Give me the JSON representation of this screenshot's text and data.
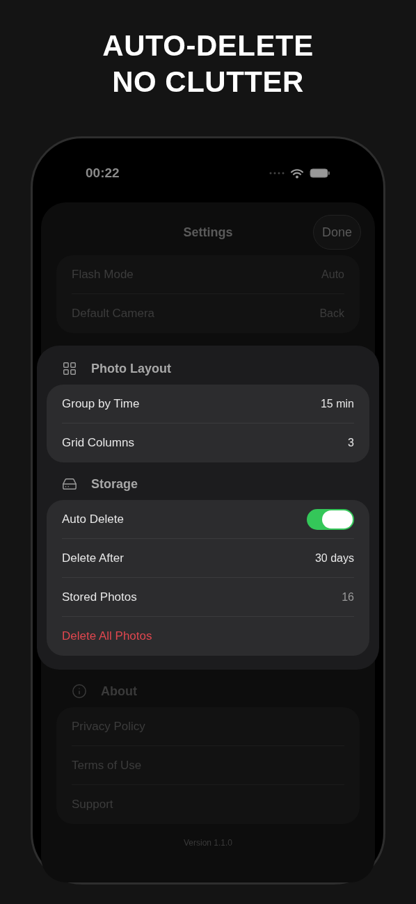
{
  "headline": [
    "AUTO-DELETE",
    "NO CLUTTER"
  ],
  "status_bar": {
    "time": "00:22"
  },
  "nav": {
    "title": "Settings",
    "done": "Done"
  },
  "sections": [
    {
      "focused": false,
      "rows": [
        {
          "kind": "value",
          "label": "Flash Mode",
          "value": "Auto"
        },
        {
          "kind": "value",
          "label": "Default Camera",
          "value": "Back"
        }
      ]
    },
    {
      "kind": "layout",
      "title": "Photo Layout",
      "focused": true,
      "rows": [
        {
          "kind": "value",
          "label": "Group by Time",
          "value": "15 min"
        },
        {
          "kind": "value",
          "label": "Grid Columns",
          "value": "3"
        }
      ]
    },
    {
      "kind": "storage",
      "title": "Storage",
      "focused": true,
      "rows": [
        {
          "kind": "toggle",
          "label": "Auto Delete",
          "on": true
        },
        {
          "kind": "value",
          "label": "Delete After",
          "value": "30 days"
        },
        {
          "kind": "count",
          "label": "Stored Photos",
          "value": "16"
        },
        {
          "kind": "destructive",
          "label": "Delete All Photos"
        }
      ]
    },
    {
      "kind": "about",
      "title": "About",
      "focused": false,
      "rows": [
        {
          "kind": "link",
          "label": "Privacy Policy"
        },
        {
          "kind": "link",
          "label": "Terms of Use"
        },
        {
          "kind": "link",
          "label": "Support"
        }
      ]
    }
  ],
  "version": "Version 1.1.0"
}
